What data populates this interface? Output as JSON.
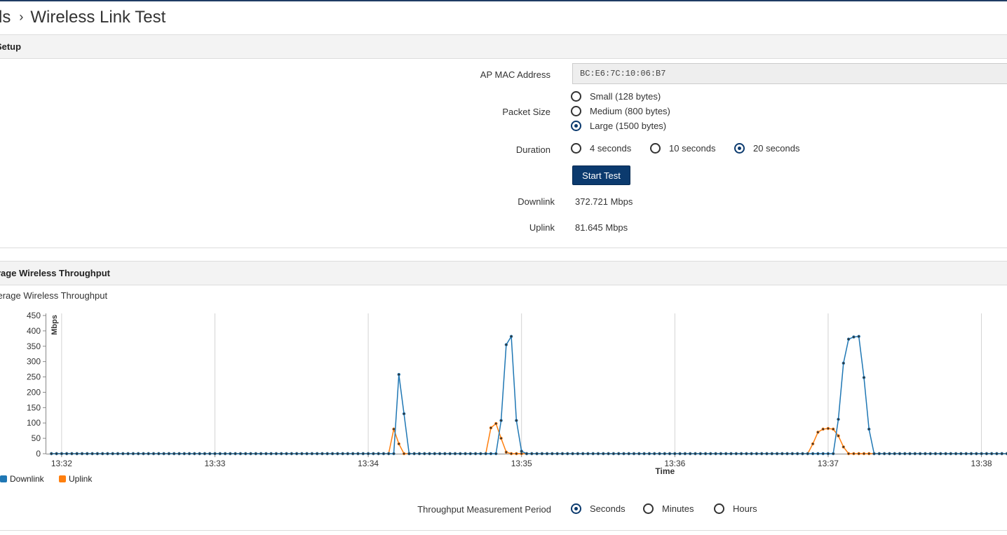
{
  "breadcrumb": {
    "parent": "ls",
    "current": "Wireless Link Test"
  },
  "setup": {
    "header": "t Setup",
    "mac_label": "AP MAC Address",
    "mac_value": "BC:E6:7C:10:06:B7",
    "packet_label": "Packet Size",
    "packet_options": [
      "Small (128 bytes)",
      "Medium (800 bytes)",
      "Large (1500 bytes)"
    ],
    "packet_selected": "Large (1500 bytes)",
    "duration_label": "Duration",
    "duration_options": [
      "4 seconds",
      "10 seconds",
      "20 seconds"
    ],
    "duration_selected": "20 seconds",
    "start_button": "Start Test",
    "downlink_label": "Downlink",
    "downlink_value": "372.721 Mbps",
    "uplink_label": "Uplink",
    "uplink_value": "81.645 Mbps"
  },
  "throughput": {
    "header": "rage Wireless Throughput",
    "chart_title": "verage Wireless Throughput",
    "period_label": "Throughput Measurement Period",
    "period_options": [
      "Seconds",
      "Minutes",
      "Hours"
    ],
    "period_selected": "Seconds"
  },
  "colors": {
    "accent": "#0b3a6e",
    "downlink": "#1f77b4",
    "uplink": "#ff7f0e"
  },
  "chart_data": {
    "type": "line",
    "title": "",
    "xlabel": "Time",
    "ylabel": "Mbps",
    "ylim": [
      0,
      450
    ],
    "yticks": [
      0,
      50,
      100,
      150,
      200,
      250,
      300,
      350,
      400,
      450
    ],
    "xlim": [
      "13:31:54",
      "13:38:10"
    ],
    "xticks": [
      "13:32",
      "13:33",
      "13:34",
      "13:35",
      "13:36",
      "13:37",
      "13:38"
    ],
    "grid": "vertical",
    "legend": "bottom-left",
    "series": [
      {
        "name": "Downlink",
        "color": "#1f77b4",
        "points": [
          [
            "13:34:10",
            0
          ],
          [
            "13:34:12",
            258
          ],
          [
            "13:34:14",
            130
          ],
          [
            "13:34:16",
            0
          ],
          [
            "13:34:50",
            0
          ],
          [
            "13:34:52",
            108
          ],
          [
            "13:34:54",
            355
          ],
          [
            "13:34:56",
            382
          ],
          [
            "13:34:58",
            108
          ],
          [
            "13:35:00",
            8
          ],
          [
            "13:35:02",
            0
          ],
          [
            "13:37:02",
            0
          ],
          [
            "13:37:04",
            112
          ],
          [
            "13:37:06",
            295
          ],
          [
            "13:37:08",
            373
          ],
          [
            "13:37:10",
            380
          ],
          [
            "13:37:12",
            382
          ],
          [
            "13:37:14",
            248
          ],
          [
            "13:37:16",
            80
          ],
          [
            "13:37:18",
            0
          ]
        ]
      },
      {
        "name": "Uplink",
        "color": "#ff7f0e",
        "points": [
          [
            "13:34:08",
            0
          ],
          [
            "13:34:10",
            80
          ],
          [
            "13:34:12",
            32
          ],
          [
            "13:34:14",
            0
          ],
          [
            "13:34:46",
            0
          ],
          [
            "13:34:48",
            84
          ],
          [
            "13:34:50",
            98
          ],
          [
            "13:34:52",
            50
          ],
          [
            "13:34:54",
            5
          ],
          [
            "13:34:56",
            0
          ],
          [
            "13:36:52",
            0
          ],
          [
            "13:36:54",
            32
          ],
          [
            "13:36:56",
            70
          ],
          [
            "13:36:58",
            80
          ],
          [
            "13:37:00",
            82
          ],
          [
            "13:37:02",
            80
          ],
          [
            "13:37:04",
            58
          ],
          [
            "13:37:06",
            22
          ],
          [
            "13:37:08",
            0
          ]
        ]
      }
    ]
  }
}
